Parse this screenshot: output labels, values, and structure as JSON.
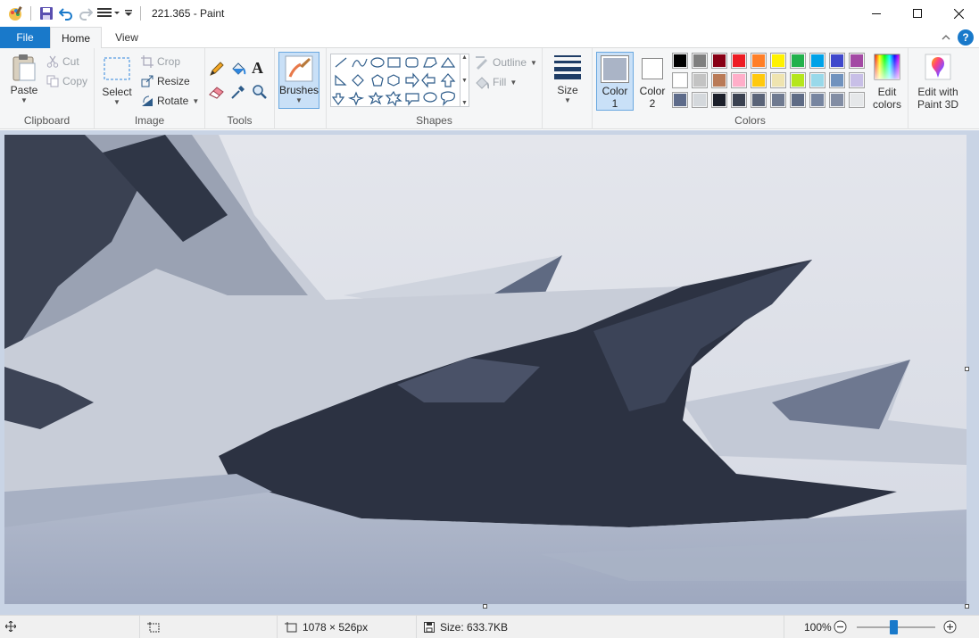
{
  "window": {
    "title": "221.365 - Paint",
    "minimize_icon": "minimize-icon",
    "maximize_icon": "maximize-icon",
    "close_icon": "close-icon"
  },
  "tabs": {
    "file": "File",
    "home": "Home",
    "view": "View"
  },
  "ribbon": {
    "clipboard": {
      "label": "Clipboard",
      "paste": "Paste",
      "cut": "Cut",
      "copy": "Copy"
    },
    "image": {
      "label": "Image",
      "select": "Select",
      "crop": "Crop",
      "resize": "Resize",
      "rotate": "Rotate"
    },
    "tools": {
      "label": "Tools"
    },
    "brushes": {
      "label": "Brushes"
    },
    "shapes": {
      "label": "Shapes",
      "outline": "Outline",
      "fill": "Fill"
    },
    "size": {
      "label": "Size"
    },
    "colors": {
      "label": "Colors",
      "color1_line1": "Color",
      "color1_line2": "1",
      "color2_line1": "Color",
      "color2_line2": "2",
      "edit_line1": "Edit",
      "edit_line2": "colors",
      "color1_value": "#aab4c6",
      "color2_value": "#ffffff",
      "palette_row1": [
        "#000000",
        "#7f7f7f",
        "#880015",
        "#ed1c24",
        "#ff7f27",
        "#fff200",
        "#22b14c",
        "#00a2e8",
        "#3f48cc",
        "#a349a4"
      ],
      "palette_row2": [
        "#ffffff",
        "#c3c3c3",
        "#b97a57",
        "#ffaec9",
        "#ffc90e",
        "#efe4b0",
        "#b5e61d",
        "#99d9ea",
        "#7092be",
        "#c8bfe7"
      ],
      "palette_row3": [
        "#5d6b8a",
        "#d4d8dc",
        "#1b1f2a",
        "#3a4150",
        "#5a6478",
        "#6f7a90",
        "#5e6b85",
        "#7785a0",
        "#828da4",
        "#e5e7e9"
      ]
    },
    "paint3d": {
      "line1": "Edit with",
      "line2": "Paint 3D"
    }
  },
  "status": {
    "dimensions": "1078 × 526px",
    "size": "Size: 633.7KB",
    "zoom": "100%",
    "zoom_fraction": 0.47
  }
}
